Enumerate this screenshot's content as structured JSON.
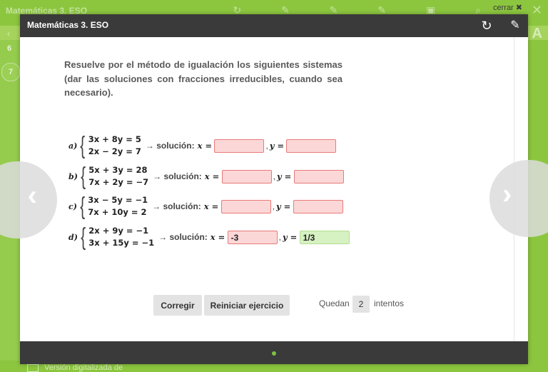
{
  "background": {
    "app_title": "Matemáticas 3. ESO",
    "close_label": "cerrar ✖",
    "page_numbers": [
      "6",
      "7"
    ],
    "bottom_label": "Versión digitalizada de",
    "font_tool": "A"
  },
  "modal": {
    "title": "Matemáticas 3. ESO",
    "reload_icon": "↻",
    "edit_icon": "✎"
  },
  "exercise": {
    "instruction": "Resuelve por el método de igualación los siguientes sistemas (dar las soluciones con fracciones irreducibles, cuando sea necesario).",
    "solution_label": "→ solución:",
    "x_label": "x =",
    "y_label": "y =",
    "systems": [
      {
        "letter": "a)",
        "eq1": "3x + 8y = 5",
        "eq2": "2x − 2y = 7",
        "x_value": "",
        "y_value": "",
        "x_status": "wrong",
        "y_status": "wrong"
      },
      {
        "letter": "b)",
        "eq1": "5x + 3y = 28",
        "eq2": "7x + 2y = −7",
        "x_value": "",
        "y_value": "",
        "x_status": "wrong",
        "y_status": "wrong"
      },
      {
        "letter": "c)",
        "eq1": "3x − 5y = −1",
        "eq2": "7x + 10y = 2",
        "x_value": "",
        "y_value": "",
        "x_status": "wrong",
        "y_status": "wrong"
      },
      {
        "letter": "d)",
        "eq1": "2x + 9y = −1",
        "eq2": "3x + 15y = −1",
        "x_value": "-3",
        "y_value": "1/3",
        "x_status": "wrong",
        "y_status": "correct"
      }
    ]
  },
  "controls": {
    "check_label": "Corregir",
    "reset_label": "Reiniciar ejercicio",
    "remaining_prefix": "Quedan",
    "remaining_count": "2",
    "remaining_suffix": "intentos"
  },
  "nav": {
    "prev_icon": "‹",
    "next_icon": "›"
  },
  "colors": {
    "accent_green": "#8cc63f",
    "header_dark": "#3a3a3a",
    "wrong_fill": "#fbd7d7",
    "correct_fill": "#d6f1c2"
  }
}
